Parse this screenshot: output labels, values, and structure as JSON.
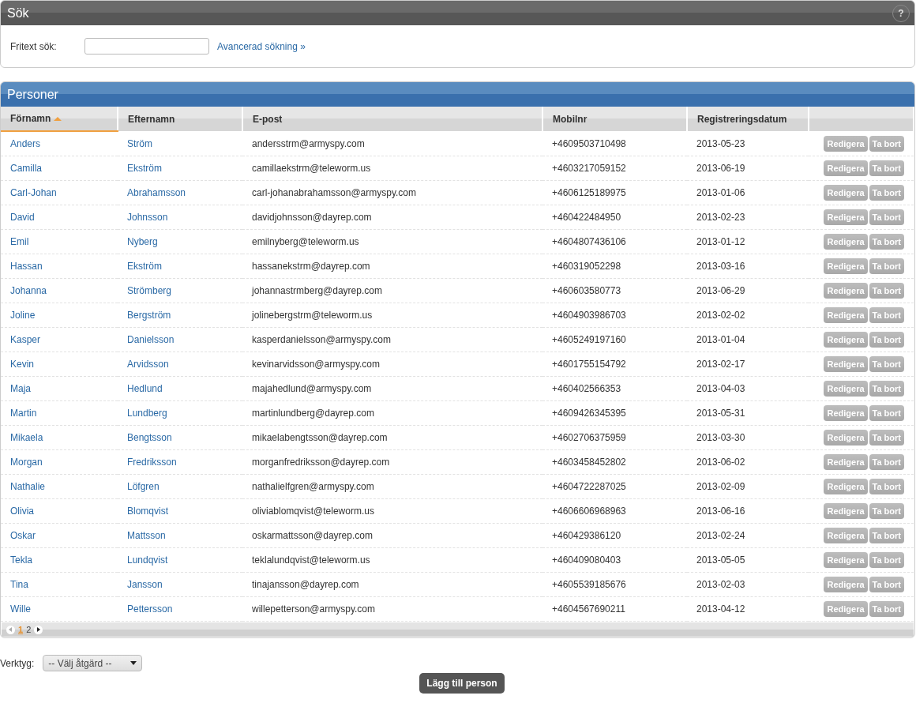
{
  "search_panel": {
    "title": "Sök",
    "help": "?",
    "free_text_label": "Fritext sök:",
    "advanced_link": "Avancerad sökning »"
  },
  "persons_panel": {
    "title": "Personer",
    "columns": [
      {
        "label": "Förnamn",
        "sorted": true
      },
      {
        "label": "Efternamn",
        "sorted": false
      },
      {
        "label": "E-post",
        "sorted": false
      },
      {
        "label": "Mobilnr",
        "sorted": false
      },
      {
        "label": "Registreringsdatum",
        "sorted": false
      }
    ],
    "rows": [
      {
        "first": "Anders",
        "last": "Ström",
        "email": "andersstrm@armyspy.com",
        "mobile": "+4609503710498",
        "date": "2013-05-23",
        "edit": "Redigera",
        "delete": "Ta bort"
      },
      {
        "first": "Camilla",
        "last": "Ekström",
        "email": "camillaekstrm@teleworm.us",
        "mobile": "+4603217059152",
        "date": "2013-06-19",
        "edit": "Redigera",
        "delete": "Ta bort"
      },
      {
        "first": "Carl-Johan",
        "last": "Abrahamsson",
        "email": "carl-johanabrahamsson@armyspy.com",
        "mobile": "+4606125189975",
        "date": "2013-01-06",
        "edit": "Redigera",
        "delete": "Ta bort"
      },
      {
        "first": "David",
        "last": "Johnsson",
        "email": "davidjohnsson@dayrep.com",
        "mobile": "+460422484950",
        "date": "2013-02-23",
        "edit": "Redigera",
        "delete": "Ta bort"
      },
      {
        "first": "Emil",
        "last": "Nyberg",
        "email": "emilnyberg@teleworm.us",
        "mobile": "+4604807436106",
        "date": "2013-01-12",
        "edit": "Redigera",
        "delete": "Ta bort"
      },
      {
        "first": "Hassan",
        "last": "Ekström",
        "email": "hassanekstrm@dayrep.com",
        "mobile": "+460319052298",
        "date": "2013-03-16",
        "edit": "Redigera",
        "delete": "Ta bort"
      },
      {
        "first": "Johanna",
        "last": "Strömberg",
        "email": "johannastrmberg@dayrep.com",
        "mobile": "+460603580773",
        "date": "2013-06-29",
        "edit": "Redigera",
        "delete": "Ta bort"
      },
      {
        "first": "Joline",
        "last": "Bergström",
        "email": "jolinebergstrm@teleworm.us",
        "mobile": "+4604903986703",
        "date": "2013-02-02",
        "edit": "Redigera",
        "delete": "Ta bort"
      },
      {
        "first": "Kasper",
        "last": "Danielsson",
        "email": "kasperdanielsson@armyspy.com",
        "mobile": "+4605249197160",
        "date": "2013-01-04",
        "edit": "Redigera",
        "delete": "Ta bort"
      },
      {
        "first": "Kevin",
        "last": "Arvidsson",
        "email": "kevinarvidsson@armyspy.com",
        "mobile": "+4601755154792",
        "date": "2013-02-17",
        "edit": "Redigera",
        "delete": "Ta bort"
      },
      {
        "first": "Maja",
        "last": "Hedlund",
        "email": "majahedlund@armyspy.com",
        "mobile": "+460402566353",
        "date": "2013-04-03",
        "edit": "Redigera",
        "delete": "Ta bort"
      },
      {
        "first": "Martin",
        "last": "Lundberg",
        "email": "martinlundberg@dayrep.com",
        "mobile": "+4609426345395",
        "date": "2013-05-31",
        "edit": "Redigera",
        "delete": "Ta bort"
      },
      {
        "first": "Mikaela",
        "last": "Bengtsson",
        "email": "mikaelabengtsson@dayrep.com",
        "mobile": "+4602706375959",
        "date": "2013-03-30",
        "edit": "Redigera",
        "delete": "Ta bort"
      },
      {
        "first": "Morgan",
        "last": "Fredriksson",
        "email": "morganfredriksson@dayrep.com",
        "mobile": "+4603458452802",
        "date": "2013-06-02",
        "edit": "Redigera",
        "delete": "Ta bort"
      },
      {
        "first": "Nathalie",
        "last": "Löfgren",
        "email": "nathalielfgren@armyspy.com",
        "mobile": "+4604722287025",
        "date": "2013-02-09",
        "edit": "Redigera",
        "delete": "Ta bort"
      },
      {
        "first": "Olivia",
        "last": "Blomqvist",
        "email": "oliviablomqvist@teleworm.us",
        "mobile": "+4606606968963",
        "date": "2013-06-16",
        "edit": "Redigera",
        "delete": "Ta bort"
      },
      {
        "first": "Oskar",
        "last": "Mattsson",
        "email": "oskarmattsson@dayrep.com",
        "mobile": "+460429386120",
        "date": "2013-02-24",
        "edit": "Redigera",
        "delete": "Ta bort"
      },
      {
        "first": "Tekla",
        "last": "Lundqvist",
        "email": "teklalundqvist@teleworm.us",
        "mobile": "+460409080403",
        "date": "2013-05-05",
        "edit": "Redigera",
        "delete": "Ta bort"
      },
      {
        "first": "Tina",
        "last": "Jansson",
        "email": "tinajansson@dayrep.com",
        "mobile": "+4605539185676",
        "date": "2013-02-03",
        "edit": "Redigera",
        "delete": "Ta bort"
      },
      {
        "first": "Wille",
        "last": "Pettersson",
        "email": "willepetterson@armyspy.com",
        "mobile": "+4604567690211",
        "date": "2013-04-12",
        "edit": "Redigera",
        "delete": "Ta bort"
      }
    ],
    "pages": [
      {
        "label": "1",
        "selected": true
      },
      {
        "label": "2",
        "selected": false
      }
    ]
  },
  "tools": {
    "label": "Verktyg:",
    "select_value": "-- Välj åtgärd --"
  },
  "add_button": "Lägg till person"
}
